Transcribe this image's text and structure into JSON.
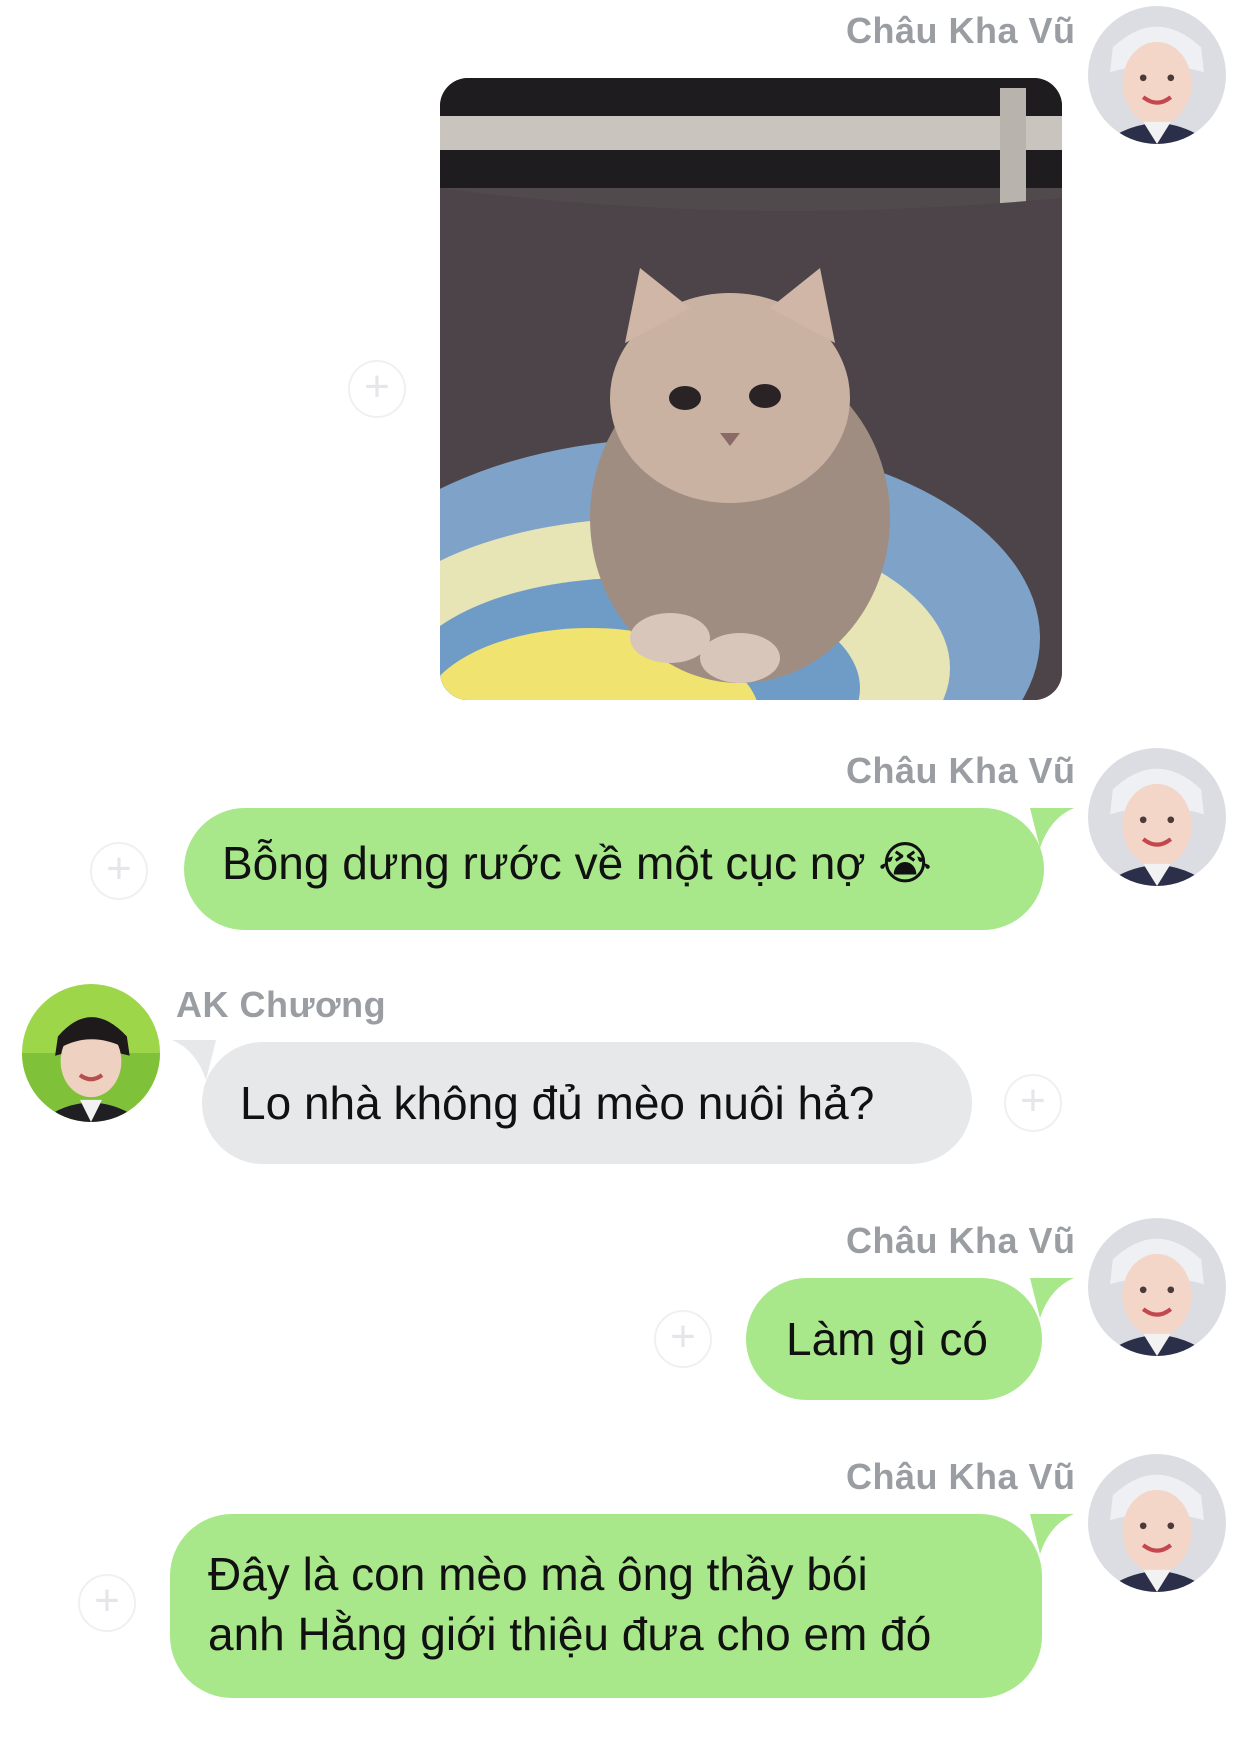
{
  "chat": {
    "messages": [
      {
        "sender": "Châu Kha Vũ",
        "type": "image",
        "image_alt": "kitten-photo"
      },
      {
        "sender": "Châu Kha Vũ",
        "type": "text",
        "text": "Bỗng dưng rước về một cục nợ 😭"
      },
      {
        "sender": "AK Chương",
        "type": "text",
        "text": "Lo nhà không đủ mèo nuôi hả?"
      },
      {
        "sender": "Châu Kha Vũ",
        "type": "text",
        "text": "Làm gì có"
      },
      {
        "sender": "Châu Kha Vũ",
        "type": "text",
        "lines": [
          "Đây là con mèo mà ông thầy bói",
          "anh Hằng giới thiệu đưa cho em đó"
        ]
      }
    ]
  },
  "colors": {
    "outgoing_bubble": "#a8e88a",
    "incoming_bubble": "#e7e8ea",
    "sender_name": "#9a9ea3"
  },
  "icons": {
    "reaction": "plus-icon"
  }
}
